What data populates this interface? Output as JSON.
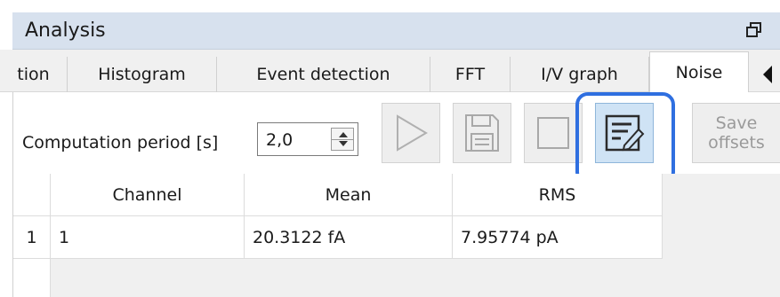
{
  "panel": {
    "title": "Analysis"
  },
  "tabs": [
    {
      "label": "tion"
    },
    {
      "label": "Histogram"
    },
    {
      "label": "Event detection"
    },
    {
      "label": "FFT"
    },
    {
      "label": "I/V graph"
    },
    {
      "label": "Noise"
    }
  ],
  "toolbar": {
    "computation_label": "Computation period [s]",
    "computation_value": "2,0",
    "save_offsets_line1": "Save",
    "save_offsets_line2": "offsets"
  },
  "table": {
    "columns": [
      "Channel",
      "Mean",
      "RMS"
    ],
    "rows": [
      {
        "index": "1",
        "channel": "1",
        "mean": "20.3122 fA",
        "rms": "7.95774 pA"
      }
    ]
  },
  "colors": {
    "header_bg": "#d7e1ee",
    "highlight": "#2f6fe0",
    "selected_button": "#cfe3f5"
  }
}
